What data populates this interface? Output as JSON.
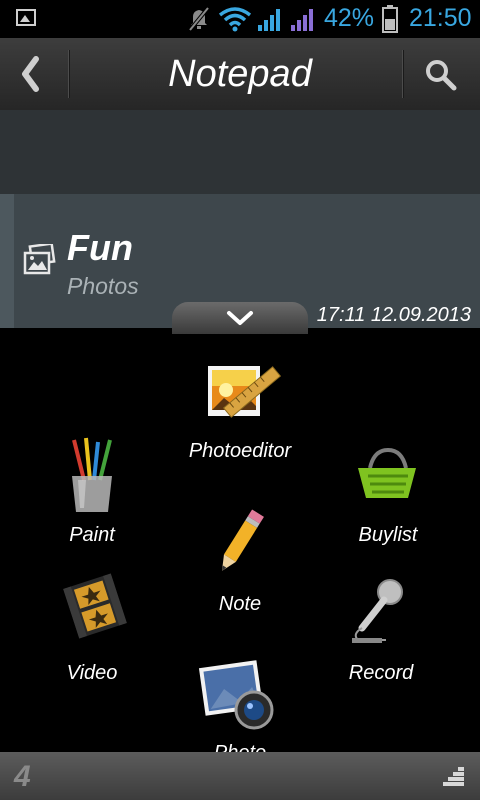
{
  "status": {
    "battery": "42%",
    "time": "21:50"
  },
  "header": {
    "title": "Notepad",
    "back_icon": "chevron-left-icon",
    "search_icon": "search-icon"
  },
  "note": {
    "title": "Fun",
    "type": "Photos",
    "date": "17:11  12.09.2013"
  },
  "menu": {
    "photoeditor": "Photoeditor",
    "paint": "Paint",
    "buylist": "Buylist",
    "note": "Note",
    "video": "Video",
    "record": "Record",
    "photo": "Photo"
  },
  "footer": {
    "count": "4"
  },
  "colors": {
    "accent": "#39a7e0",
    "background": "#000000",
    "card": "#3e474c"
  }
}
